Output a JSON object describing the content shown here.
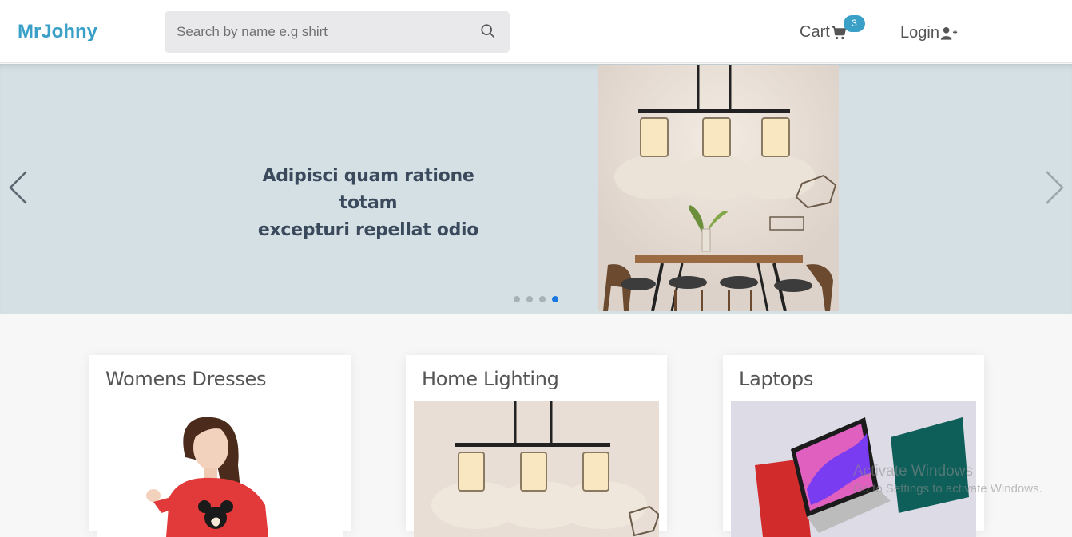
{
  "header": {
    "logo": "MrJohny",
    "search_placeholder": "Search by name e.g shirt",
    "cart_label": "Cart",
    "cart_count": "3",
    "login_label": "Login"
  },
  "carousel": {
    "caption_line1": "Adipisci quam ratione totam",
    "caption_line2": "excepturi repellat odio",
    "slides": 4,
    "active_slide": 4
  },
  "categories": [
    {
      "title": "Womens Dresses",
      "image": "woman-image"
    },
    {
      "title": "Home Lighting",
      "image": "pendant-lamp-image"
    },
    {
      "title": "Laptops",
      "image": "laptops-image"
    }
  ],
  "watermark": {
    "line1": "Activate Windows",
    "line2": "Go to Settings to activate Windows."
  },
  "colors": {
    "brand": "#3aa0c8",
    "carousel_bg": "#d4e0e4",
    "active_dot": "#1a78e0"
  }
}
